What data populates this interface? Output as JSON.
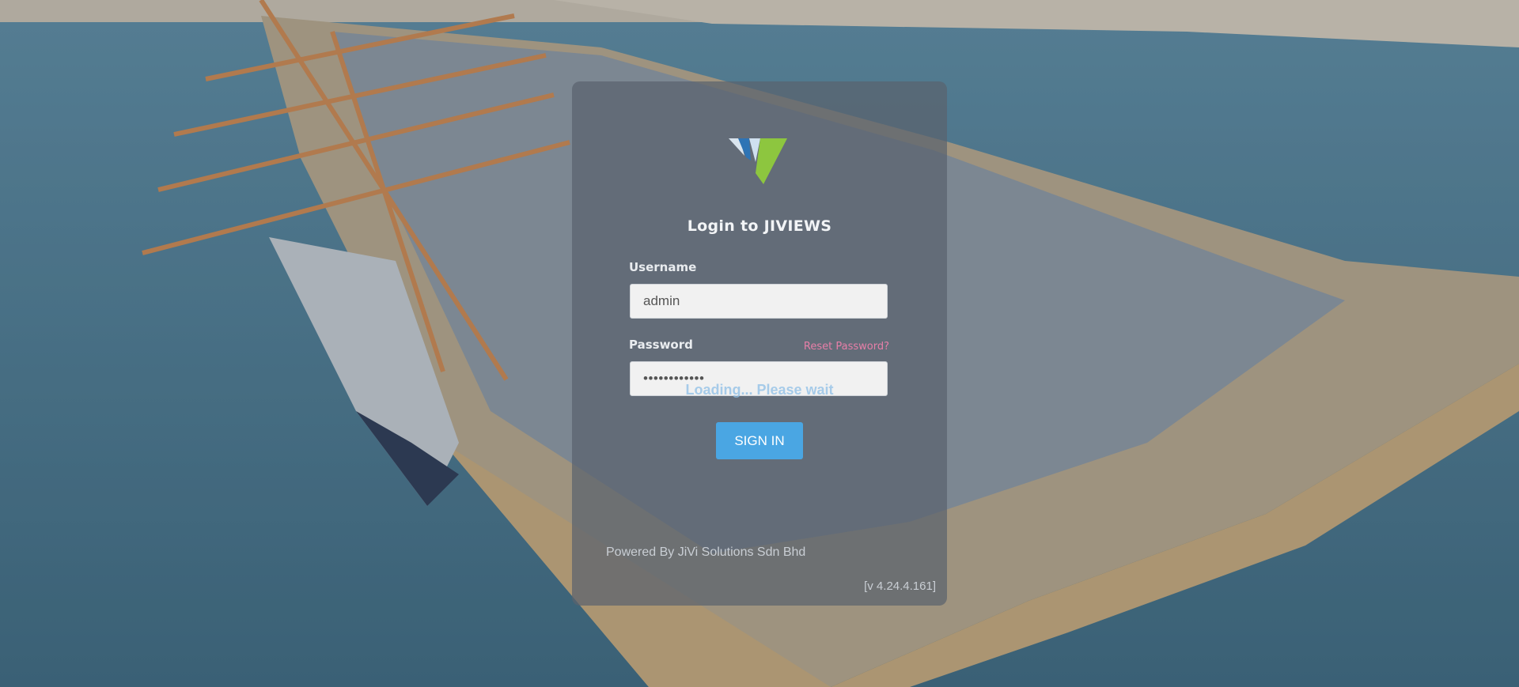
{
  "login": {
    "title": "Login to JIVIEWS",
    "username_label": "Username",
    "username_value": "admin",
    "password_label": "Password",
    "password_value": "••••••••••••",
    "reset_link": "Reset Password?",
    "loading_text": "Loading... Please wait",
    "sign_in_label": "SIGN IN"
  },
  "footer": {
    "powered_by": "Powered By JiVi Solutions Sdn Bhd",
    "version": "[v 4.24.4.161]"
  },
  "icons": {
    "logo": "jiviews-logo-icon"
  },
  "colors": {
    "accent": "#4aa6e3",
    "reset_link": "#e77fa8",
    "logo_blue": "#2e74b5",
    "logo_green": "#8dc63f"
  }
}
